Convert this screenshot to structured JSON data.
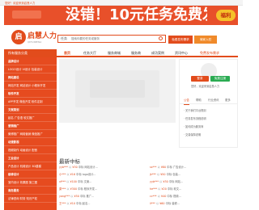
{
  "topbar": {
    "text": "您好！欢迎来到启慧人力"
  },
  "banner": {
    "headline": "没错！10元任务免费发布",
    "badge": "福利"
  },
  "logo": {
    "mark": "启",
    "name": "启慧人力",
    "sub": "QIHUIRENLI"
  },
  "search": {
    "select": "任务",
    "placeholder": "搜索你要的任务或服务"
  },
  "buttons": {
    "publish": "免费发布需求",
    "merchant": "商家入驻"
  },
  "nav": {
    "category": "所有服务分类",
    "items": [
      "首页",
      "任务大厅",
      "服务商城",
      "服务商",
      "成功案例",
      "资讯中心",
      "免费发布需求"
    ]
  },
  "sidebar": [
    "品牌设计",
    "LOGO设计  VI设计  包装设计",
    "网站建设",
    "网站开发  网站设计  小程序开发",
    "软件开发",
    "APP开发  微信开发  软件定制",
    "文案策划",
    "起名  广告语  软文推广",
    "营销推广",
    "微博推广  网络营销  微信推广",
    "动漫影视",
    "视频制作  动画设计  配音",
    "工业设计",
    "产品设计  机械设计  3D建模",
    "装修设计",
    "室内设计  效果图  施工图",
    "商务服务",
    "法律咨询  财务  知识产权"
  ],
  "right_panel": {
    "login": "登录",
    "register": "免费注册",
    "note": "您好，欢迎来到启慧人力",
    "tabs": [
      "公告",
      "帮助",
      "行业资讯",
      "更多"
    ],
    "lines": [
      "· 关于我们平台规则",
      "· 任务发布流程说明",
      "· 如何成为服务商",
      "· 交易保障说明"
    ]
  },
  "section": {
    "title": "最新中标"
  },
  "feed_left": [
    {
      "user": "yyb***",
      "action": "以",
      "price": "¥30",
      "text": "中标 网站设计..."
    },
    {
      "user": "小***",
      "action": "以",
      "price": "¥16",
      "text": "中标 logo设计..."
    },
    {
      "user": "xf***",
      "action": "以",
      "price": "¥100",
      "text": "中标 文案..."
    },
    {
      "user": "梁***",
      "action": "以",
      "price": "¥300",
      "text": "中标 程序开发..."
    },
    {
      "user": "yang***",
      "action": "以",
      "price": "¥50",
      "text": "中标 推广..."
    },
    {
      "user": "王***",
      "action": "以",
      "price": "¥10",
      "text": "中标 起名..."
    }
  ],
  "feed_right": [
    {
      "user": "ss***",
      "action": "以",
      "price": "¥80",
      "text": "中标 广告设计..."
    },
    {
      "user": "jk***",
      "action": "以",
      "price": "¥50",
      "text": "中标 包装..."
    },
    {
      "user": "yyb***",
      "action": "以",
      "price": "¥30",
      "text": "中标 网站..."
    },
    {
      "user": "he***",
      "action": "以",
      "price": "¥20",
      "text": "中标 软文..."
    },
    {
      "user": "cc***",
      "action": "以",
      "price": "¥40",
      "text": "中标 视频..."
    },
    {
      "user": "ll***",
      "action": "以",
      "price": "¥60",
      "text": "中标 装修..."
    }
  ]
}
